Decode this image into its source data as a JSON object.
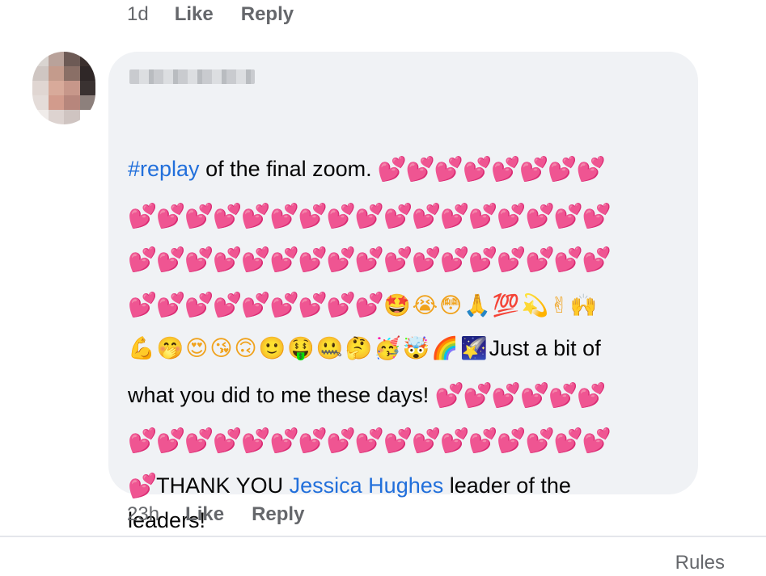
{
  "previous_comment": {
    "time": "1d",
    "like_label": "Like",
    "reply_label": "Reply"
  },
  "comment": {
    "author_name_obscured": true,
    "lines": {
      "l1": {
        "hashtag": "#replay",
        "text": " of the final zoom.",
        "hearts": "💕💕💕💕💕💕💕💕"
      },
      "l2": {
        "hearts": "💕💕💕💕💕💕💕💕💕💕💕💕💕💕💕💕💕"
      },
      "l3": {
        "hearts": "💕💕💕💕💕💕💕💕💕💕💕💕💕💕💕💕💕"
      },
      "l4": {
        "hearts": "💕💕💕💕💕💕💕💕💕",
        "emojis": "🤩😭😳🙏💯💫✌🙌"
      },
      "l5": {
        "emojis": "💪🤭😍😘🙃🙂🤑🤐🤔🥳🤯🌈🌠",
        "text": "Just a bit of"
      },
      "l6": {
        "text": "what you did to me these days! ",
        "hearts": "💕💕💕💕💕💕"
      },
      "l7": {
        "hearts": "💕💕💕💕💕💕💕💕💕💕💕💕💕💕💕💕💕"
      },
      "l8": {
        "hearts": "💕",
        "text_before": "THANK YOU ",
        "mention": "Jessica Hughes",
        "text_after": " leader of the"
      },
      "l9": {
        "text": "leaders!"
      }
    },
    "time": "23h",
    "like_label": "Like",
    "reply_label": "Reply"
  },
  "footer": {
    "rules_label": "Rules"
  },
  "colors": {
    "link": "#216fdb",
    "heart": "#ea2fa4",
    "bubble": "#f0f2f5",
    "meta": "#65676b"
  }
}
